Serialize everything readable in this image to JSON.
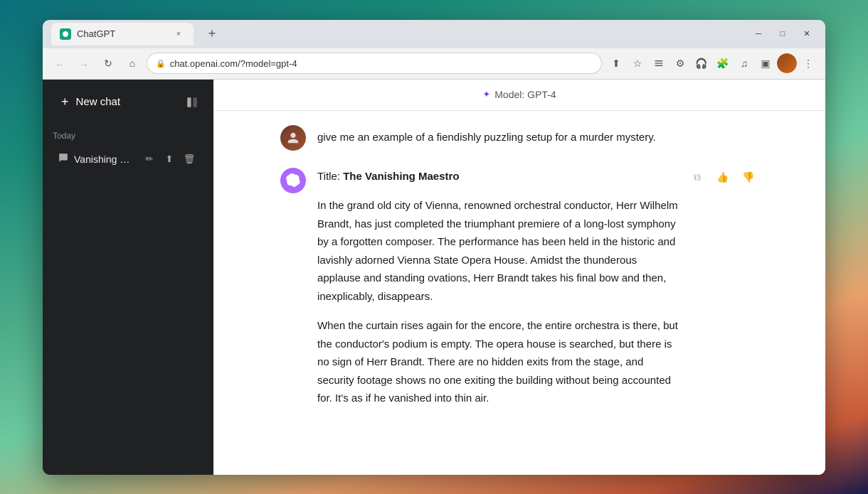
{
  "browser": {
    "tab_title": "ChatGPT",
    "tab_close": "×",
    "tab_add": "+",
    "url": "chat.openai.com/?model=gpt-4",
    "nav": {
      "back": "←",
      "forward": "→",
      "reload": "↻",
      "home": "⌂"
    },
    "window_controls": {
      "minimize": "─",
      "maximize": "□",
      "close": "✕"
    }
  },
  "sidebar": {
    "new_chat_label": "New chat",
    "toggle_icon": "▣",
    "section_today": "Today",
    "chat_item": {
      "title": "Vanishing Maestro's",
      "icon": "💬"
    }
  },
  "chat": {
    "model_label": "Model: GPT-4",
    "user_prompt": "give me an example of a fiendishly puzzling setup for a murder mystery.",
    "response_title_prefix": "Title: ",
    "response_title": "The Vanishing Maestro",
    "response_para1": "In the grand old city of Vienna, renowned orchestral conductor, Herr Wilhelm Brandt, has just completed the triumphant premiere of a long-lost symphony by a forgotten composer. The performance has been held in the historic and lavishly adorned Vienna State Opera House. Amidst the thunderous applause and standing ovations, Herr Brandt takes his final bow and then, inexplicably, disappears.",
    "response_para2": "When the curtain rises again for the encore, the entire orchestra is there, but the conductor's podium is empty. The opera house is searched, but there is no sign of Herr Brandt. There are no hidden exits from the stage, and security footage shows no one exiting the building without being accounted for. It's as if he vanished into thin air."
  }
}
